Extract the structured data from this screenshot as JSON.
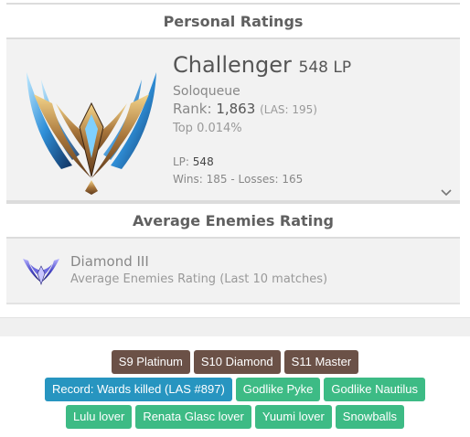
{
  "personal": {
    "heading": "Personal Ratings",
    "tier": "Challenger",
    "lp_short": "548 LP",
    "queue": "Soloqueue",
    "rank_label": "Rank:",
    "rank_value": "1,863",
    "rank_region": "(LAS: 195)",
    "top": "Top 0.014%",
    "lp_label": "LP:",
    "lp_value": "548",
    "record": "Wins: 185 - Losses: 165"
  },
  "average": {
    "heading": "Average Enemies Rating",
    "tier": "Diamond III",
    "description": "Average Enemies Rating (Last 10 matches)"
  },
  "tags": {
    "row1": [
      "S9 Platinum",
      "S10 Diamond",
      "S11 Master"
    ],
    "row2": [
      "Record: Wards killed (LAS #897)",
      "Godlike Pyke",
      "Godlike Nautilus"
    ],
    "row3": [
      "Lulu lover",
      "Renata Glasc lover",
      "Yuumi lover",
      "Snowballs"
    ]
  },
  "colors": {
    "season_tag": "#6b5147",
    "record_tag": "#2795c0",
    "champion_tag": "#3dbb85"
  },
  "icons": {
    "challenger_emblem": "challenger-emblem-icon",
    "diamond_emblem": "diamond-emblem-icon",
    "expand": "chevron-down-icon"
  }
}
